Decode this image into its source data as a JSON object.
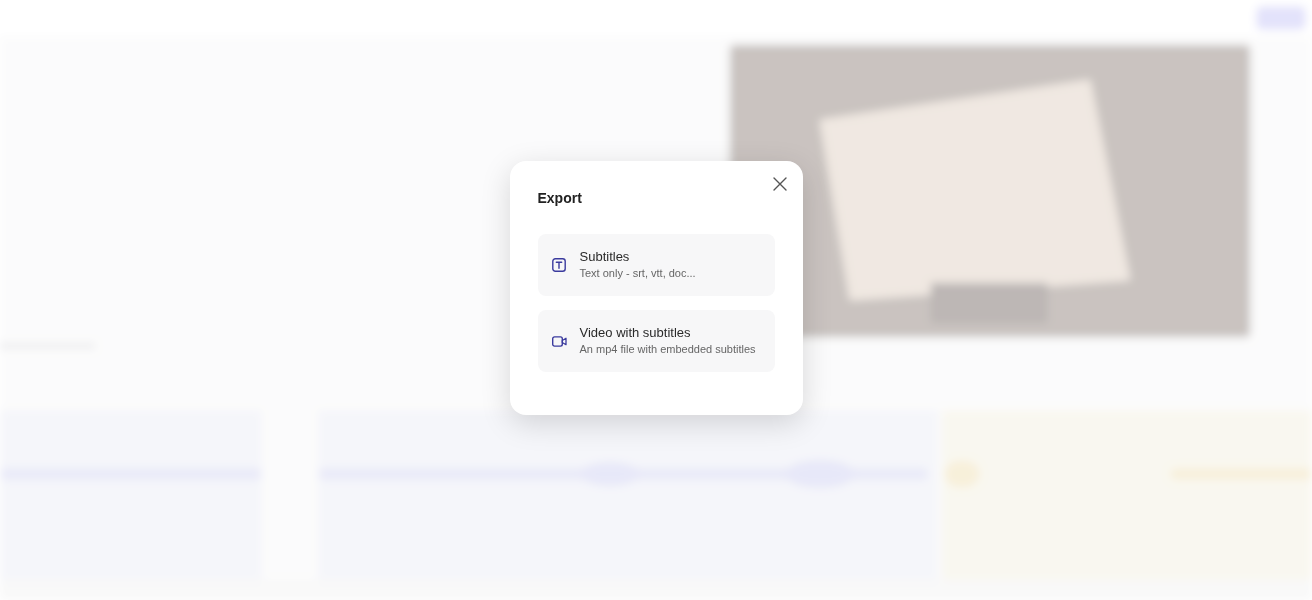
{
  "dialog": {
    "title": "Export",
    "options": [
      {
        "kind": "text",
        "title": "Subtitles",
        "description": "Text only - srt, vtt, doc..."
      },
      {
        "kind": "video",
        "title": "Video with subtitles",
        "description": "An mp4 file with embedded subtitles"
      }
    ]
  }
}
